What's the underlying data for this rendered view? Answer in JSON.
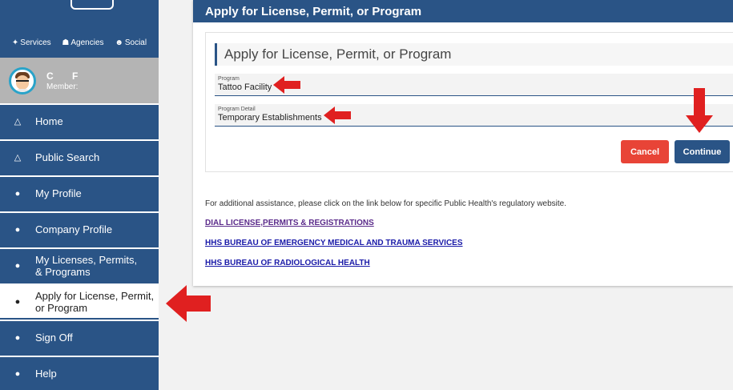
{
  "sidebar": {
    "topnav": [
      {
        "icon": "gear-icon",
        "glyph": "✦",
        "label": "Services"
      },
      {
        "icon": "building-icon",
        "glyph": "☗",
        "label": "Agencies"
      },
      {
        "icon": "social-icon",
        "glyph": "☻",
        "label": "Social"
      }
    ],
    "user": {
      "name": "C F",
      "role": "Member:"
    },
    "items": [
      {
        "icon": "triangle-icon",
        "glyph": "△",
        "label": "Home"
      },
      {
        "icon": "triangle-icon",
        "glyph": "△",
        "label": "Public Search"
      },
      {
        "icon": "palette-icon",
        "glyph": "●",
        "label": "My Profile"
      },
      {
        "icon": "palette-icon",
        "glyph": "●",
        "label": "Company Profile"
      },
      {
        "icon": "palette-icon",
        "glyph": "●",
        "label_line1": "My Licenses, Permits,",
        "label_line2": "& Programs"
      },
      {
        "icon": "palette-icon",
        "glyph": "●",
        "label_line1": "Apply for License, Permit,",
        "label_line2": "or Program",
        "active": true
      },
      {
        "icon": "palette-icon",
        "glyph": "●",
        "label": "Sign Off"
      },
      {
        "icon": "palette-icon",
        "glyph": "●",
        "label": "Help"
      }
    ]
  },
  "main": {
    "header_title": "Apply for License, Permit, or Program",
    "form": {
      "title": "Apply for License, Permit, or Program",
      "program": {
        "label": "Program",
        "value": "Tattoo Facility"
      },
      "program_detail": {
        "label": "Program Detail",
        "value": "Temporary Establishments"
      },
      "cancel_label": "Cancel",
      "continue_label": "Continue"
    },
    "assistance_text": "For additional assistance, please click on the link below for specific Public Health's regulatory website.",
    "links": [
      {
        "label": "DIAL LICENSE,PERMITS & REGISTRATIONS",
        "color": "#5a2a8a"
      },
      {
        "label": "HHS BUREAU OF EMERGENCY MEDICAL AND TRAUMA SERVICES",
        "color": "#1a1aa8"
      },
      {
        "label": "HHS BUREAU OF RADIOLOGICAL HEALTH",
        "color": "#1a1aa8"
      }
    ]
  },
  "colors": {
    "brand": "#2a5486",
    "cancel": "#e84437",
    "annotation_arrow": "#e02020"
  }
}
